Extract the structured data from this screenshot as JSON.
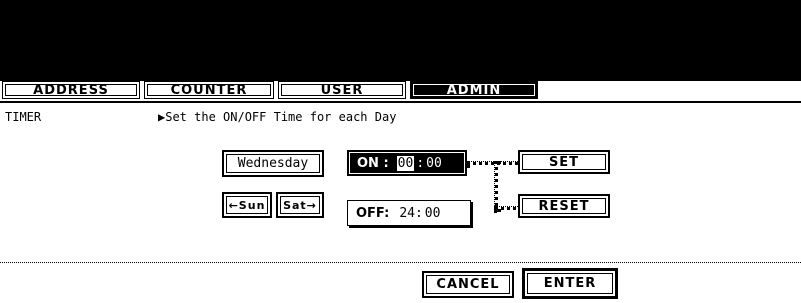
{
  "tabs": [
    {
      "label": "ADDRESS",
      "active": false
    },
    {
      "label": "COUNTER",
      "active": false
    },
    {
      "label": "USER",
      "active": false
    },
    {
      "label": "ADMIN",
      "active": true
    }
  ],
  "breadcrumb": {
    "section": "TIMER",
    "instruction": "▶Set the ON/OFF Time for each Day"
  },
  "day": {
    "selected": "Wednesday",
    "prev_label": "←Sun",
    "next_label": "Sat→"
  },
  "on_time": {
    "label": "ON :",
    "hours": "00",
    "sep": ":",
    "minutes": "00"
  },
  "off_time": {
    "label": "OFF:",
    "hours": "24",
    "sep": ":",
    "minutes": "00"
  },
  "actions": {
    "set": "SET",
    "reset": "RESET",
    "cancel": "CANCEL",
    "enter": "ENTER"
  }
}
